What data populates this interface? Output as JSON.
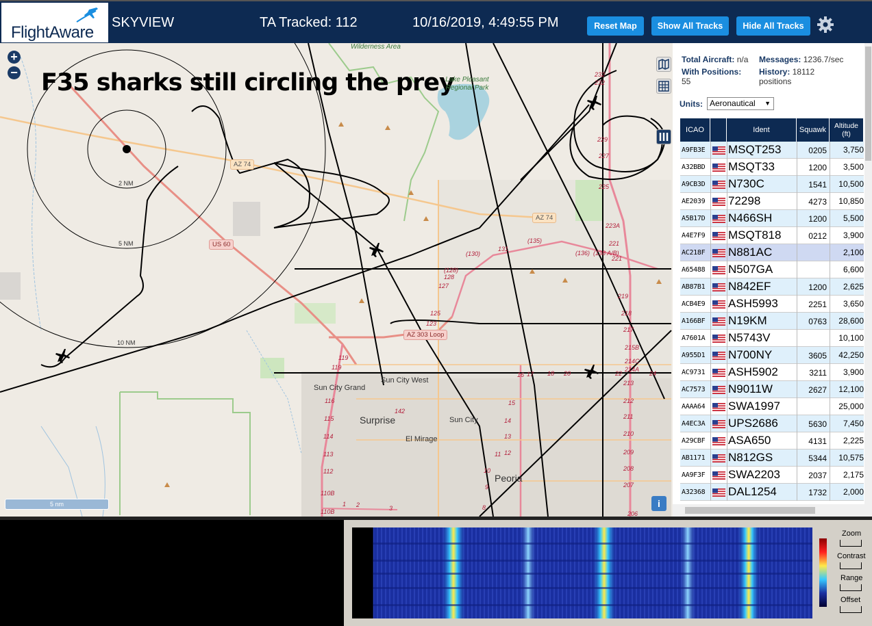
{
  "header": {
    "logo": "FlightAware",
    "app_title": "SKYVIEW",
    "tracked": "TA Tracked: 112",
    "datetime": "10/16/2019, 4:49:55 PM",
    "buttons": {
      "reset": "Reset Map",
      "show_all": "Show All Tracks",
      "hide_all": "Hide All Tracks"
    },
    "icons": {
      "settings": "gear-icon",
      "logo_plane": "airplane-icon"
    }
  },
  "map": {
    "overlay_title": "F35 sharks still circling the prey",
    "scale_label": "5 nm",
    "info_label": "i",
    "zoom_in": "+",
    "zoom_out": "−",
    "ring_labels": [
      "2 NM",
      "5 NM",
      "10 NM"
    ],
    "places": [
      "Wilderness Area",
      "Lake Pleasant Regional Park",
      "Sun City West",
      "Sun City Grand",
      "Surprise",
      "Sun City",
      "El Mirage",
      "Peoria"
    ],
    "road_badges": [
      "AZ 74",
      "AZ 74",
      "US 60",
      "AZ 303 Loop"
    ],
    "route_numbers": [
      "(130)",
      "131",
      "(135)",
      "(136)",
      "(138 A/B)",
      "221",
      "(128)",
      "127",
      "128",
      "125",
      "123",
      "119",
      "119",
      "116",
      "115",
      "114",
      "113",
      "112",
      "110B",
      "110B",
      "142",
      "1",
      "2",
      "3",
      "17",
      "16",
      "18",
      "20",
      "22",
      "24",
      "232",
      "232",
      "229",
      "227",
      "225",
      "223A",
      "221",
      "219",
      "218",
      "217",
      "215B",
      "214C",
      "214A",
      "213",
      "212",
      "211",
      "210",
      "209",
      "208",
      "207",
      "206",
      "14",
      "13",
      "12",
      "11",
      "10",
      "9",
      "8",
      "15"
    ]
  },
  "sidebar": {
    "stats": {
      "total_label": "Total Aircraft:",
      "total_value": "n/a",
      "messages_label": "Messages:",
      "messages_value": "1236.7/sec",
      "positions_label": "With Positions:",
      "positions_value": "55",
      "history_label": "History:",
      "history_value": "18112 positions"
    },
    "units_label": "Units:",
    "units_value": "Aeronautical",
    "columns": [
      "ICAO",
      "",
      "Ident",
      "Squawk",
      "Altitude (ft)"
    ],
    "rows": [
      {
        "icao": "A9FB3E",
        "ident": "MSQT253",
        "squawk": "0205",
        "alt": "3,750"
      },
      {
        "icao": "A32BBD",
        "ident": "MSQT33",
        "squawk": "1200",
        "alt": "3,500"
      },
      {
        "icao": "A9CB3D",
        "ident": "N730C",
        "squawk": "1541",
        "alt": "10,500"
      },
      {
        "icao": "AE2039",
        "ident": "72298",
        "squawk": "4273",
        "alt": "10,850"
      },
      {
        "icao": "A5B17D",
        "ident": "N466SH",
        "squawk": "1200",
        "alt": "5,500"
      },
      {
        "icao": "A4E7F9",
        "ident": "MSQT818",
        "squawk": "0212",
        "alt": "3,900"
      },
      {
        "icao": "AC218F",
        "ident": "N881AC",
        "squawk": "",
        "alt": "2,100"
      },
      {
        "icao": "A65488",
        "ident": "N507GA",
        "squawk": "",
        "alt": "6,600"
      },
      {
        "icao": "AB87B1",
        "ident": "N842EF",
        "squawk": "1200",
        "alt": "2,625"
      },
      {
        "icao": "ACB4E9",
        "ident": "ASH5993",
        "squawk": "2251",
        "alt": "3,650"
      },
      {
        "icao": "A166BF",
        "ident": "N19KM",
        "squawk": "0763",
        "alt": "28,600"
      },
      {
        "icao": "A7601A",
        "ident": "N5743V",
        "squawk": "",
        "alt": "10,100"
      },
      {
        "icao": "A955D1",
        "ident": "N700NY",
        "squawk": "3605",
        "alt": "42,250"
      },
      {
        "icao": "AC9731",
        "ident": "ASH5902",
        "squawk": "3211",
        "alt": "3,900"
      },
      {
        "icao": "AC7573",
        "ident": "N9011W",
        "squawk": "2627",
        "alt": "12,100"
      },
      {
        "icao": "AAAA64",
        "ident": "SWA1997",
        "squawk": "",
        "alt": "25,000"
      },
      {
        "icao": "A4EC3A",
        "ident": "UPS2686",
        "squawk": "5630",
        "alt": "7,450"
      },
      {
        "icao": "A29CBF",
        "ident": "ASA650",
        "squawk": "4131",
        "alt": "2,225"
      },
      {
        "icao": "AB1171",
        "ident": "N812GS",
        "squawk": "5344",
        "alt": "10,575"
      },
      {
        "icao": "AA9F3F",
        "ident": "SWA2203",
        "squawk": "2037",
        "alt": "2,175"
      },
      {
        "icao": "A32368",
        "ident": "DAL1254",
        "squawk": "1732",
        "alt": "2,000"
      }
    ]
  },
  "waterfall": {
    "labels": [
      "Zoom",
      "Contrast",
      "Range",
      "Offset"
    ]
  },
  "colors": {
    "header_bg": "#0d2a52",
    "button_bg": "#1a8ee0",
    "row_odd": "#dff0fb",
    "row_selected": "#cfd9f2"
  }
}
